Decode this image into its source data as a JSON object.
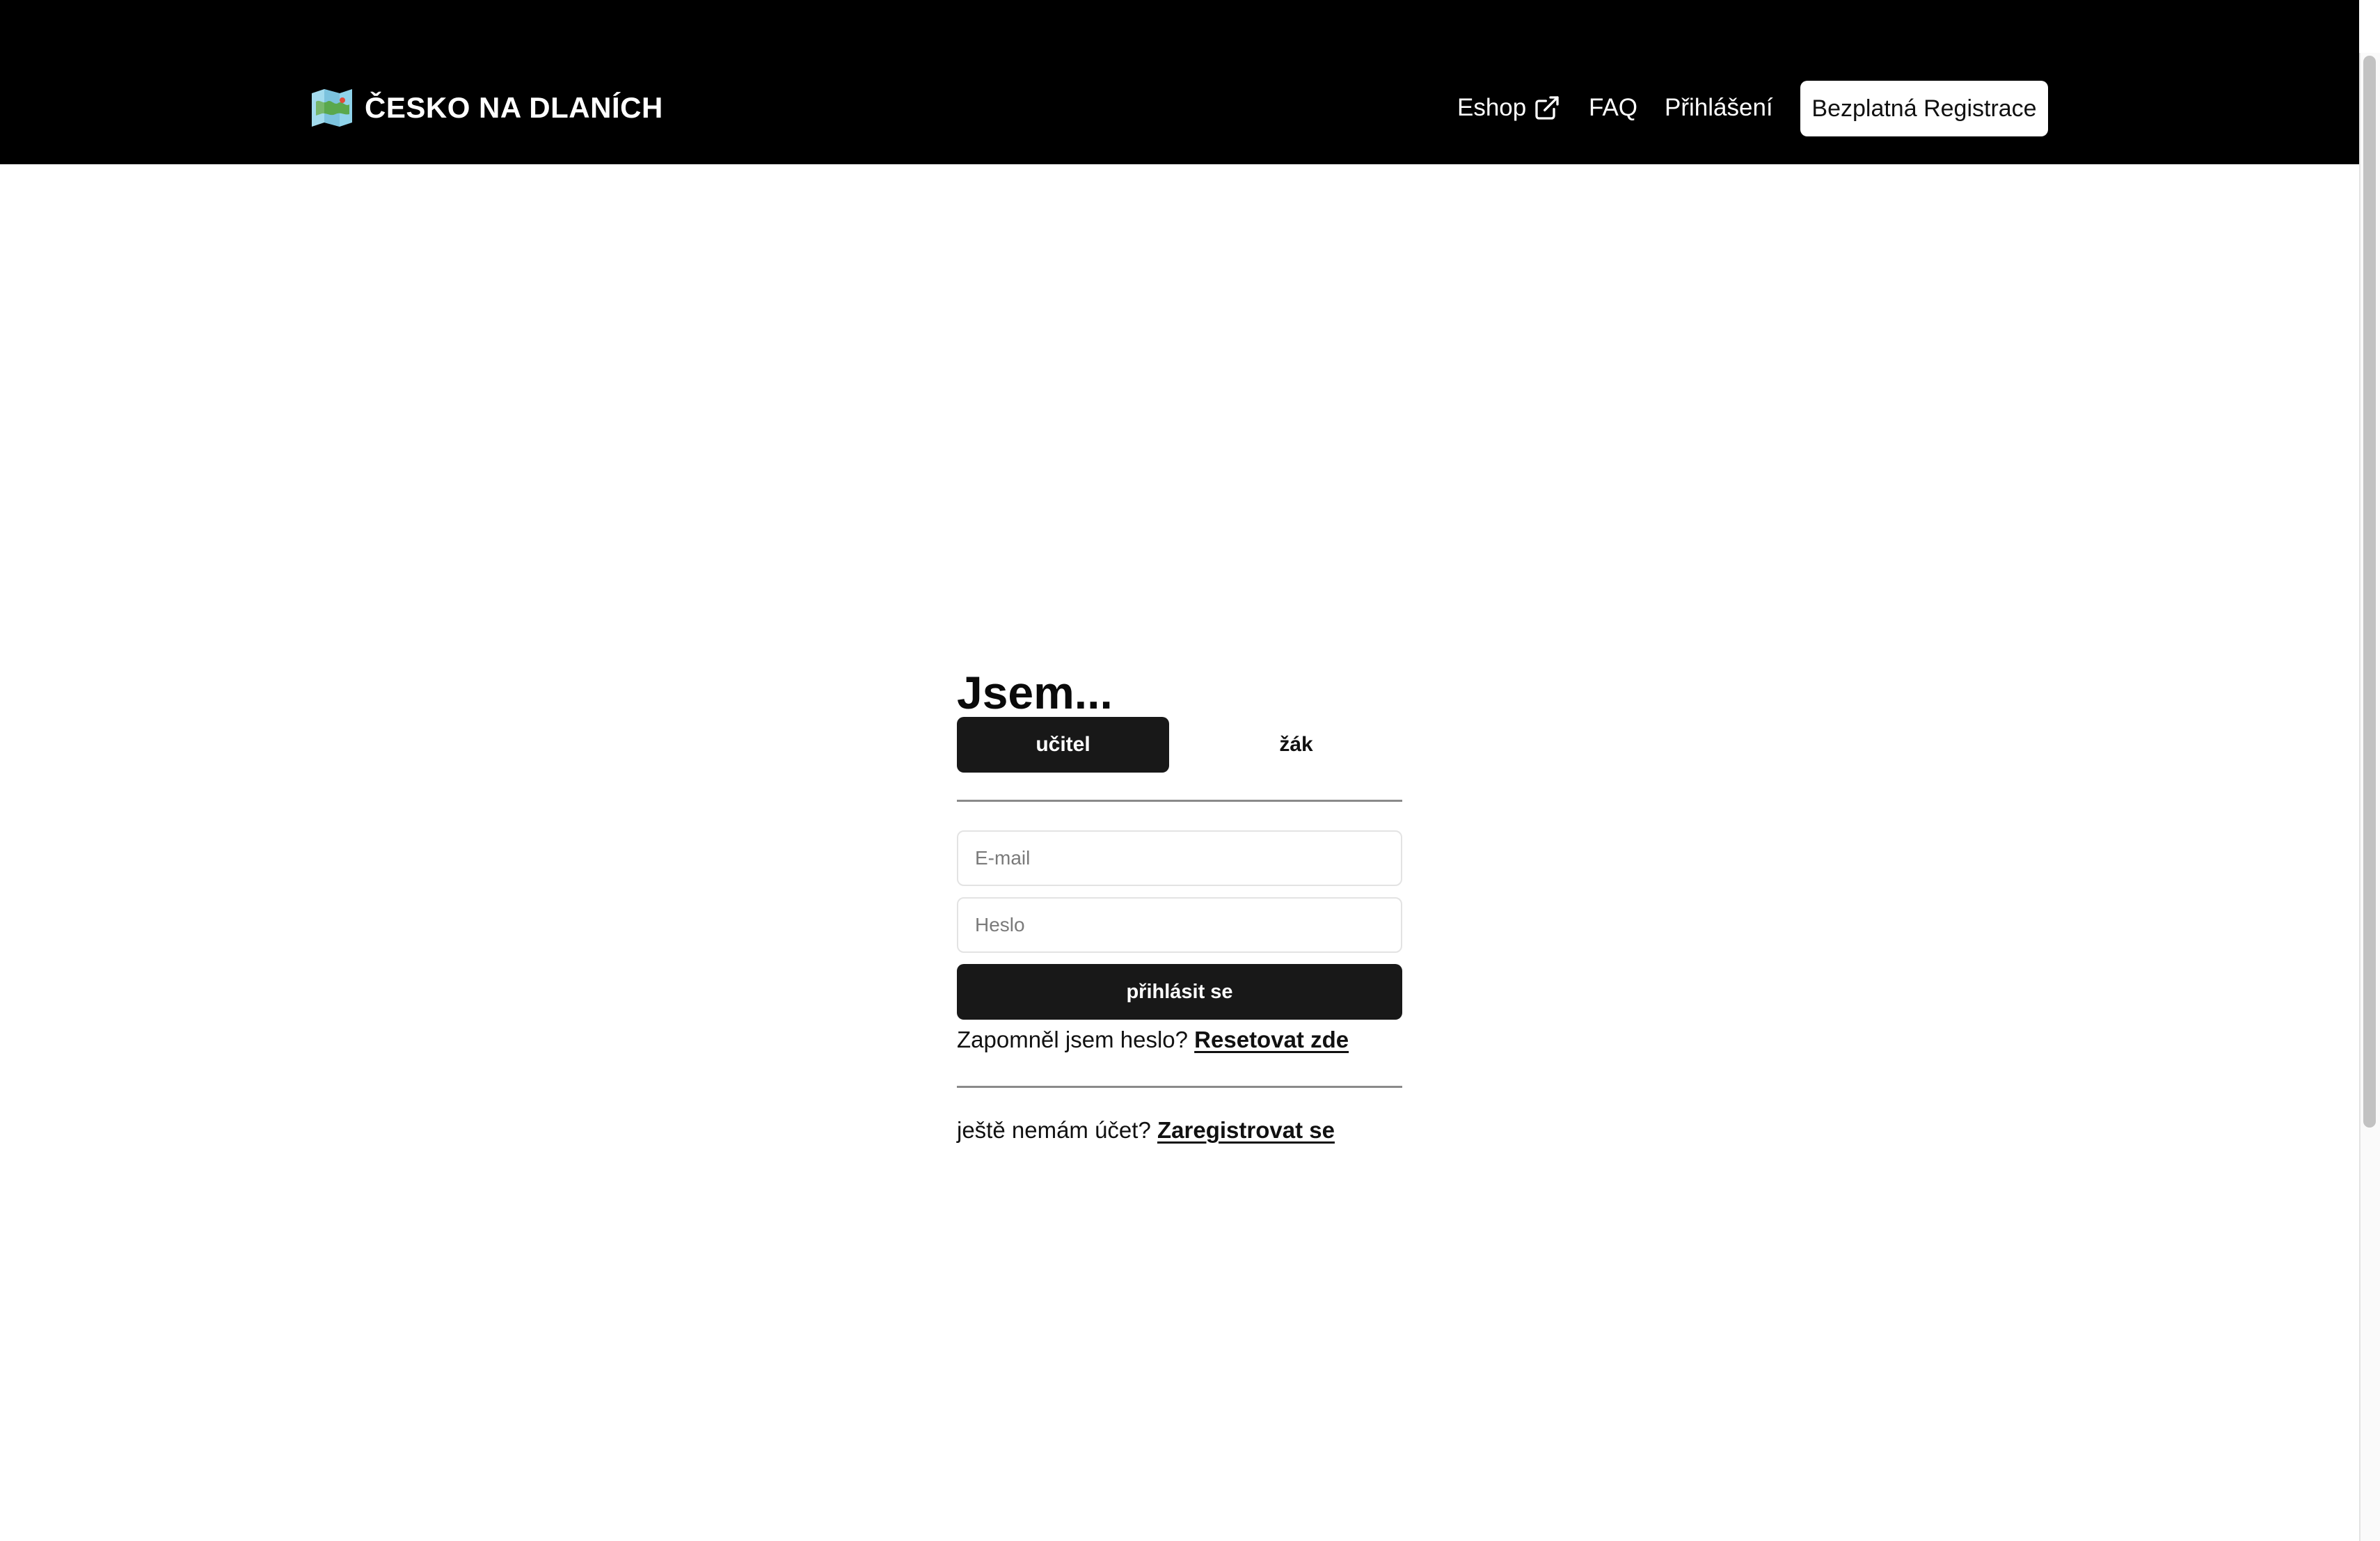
{
  "header": {
    "logo_text": "ČESKO NA DLANÍCH",
    "logo_icon": "folded-map-icon",
    "nav": {
      "eshop": "Eshop",
      "eshop_icon": "external-link-icon",
      "faq": "FAQ",
      "login": "Přihlášení"
    },
    "register_button": "Bezplatná Registrace"
  },
  "login_form": {
    "heading": "Jsem...",
    "roles": {
      "teacher": "učitel",
      "student": "žák",
      "selected": "učitel"
    },
    "email_placeholder": "E-mail",
    "password_placeholder": "Heslo",
    "submit_label": "přihlásit se",
    "forgot_text": "Zapomněl jsem heslo?",
    "forgot_link": "Resetovat zde",
    "no_account_text": "ještě nemám účet?",
    "register_link": "Zaregistrovat se"
  },
  "colors": {
    "header_bg": "#000000",
    "primary_button": "#181818",
    "page_bg": "#ffffff"
  }
}
